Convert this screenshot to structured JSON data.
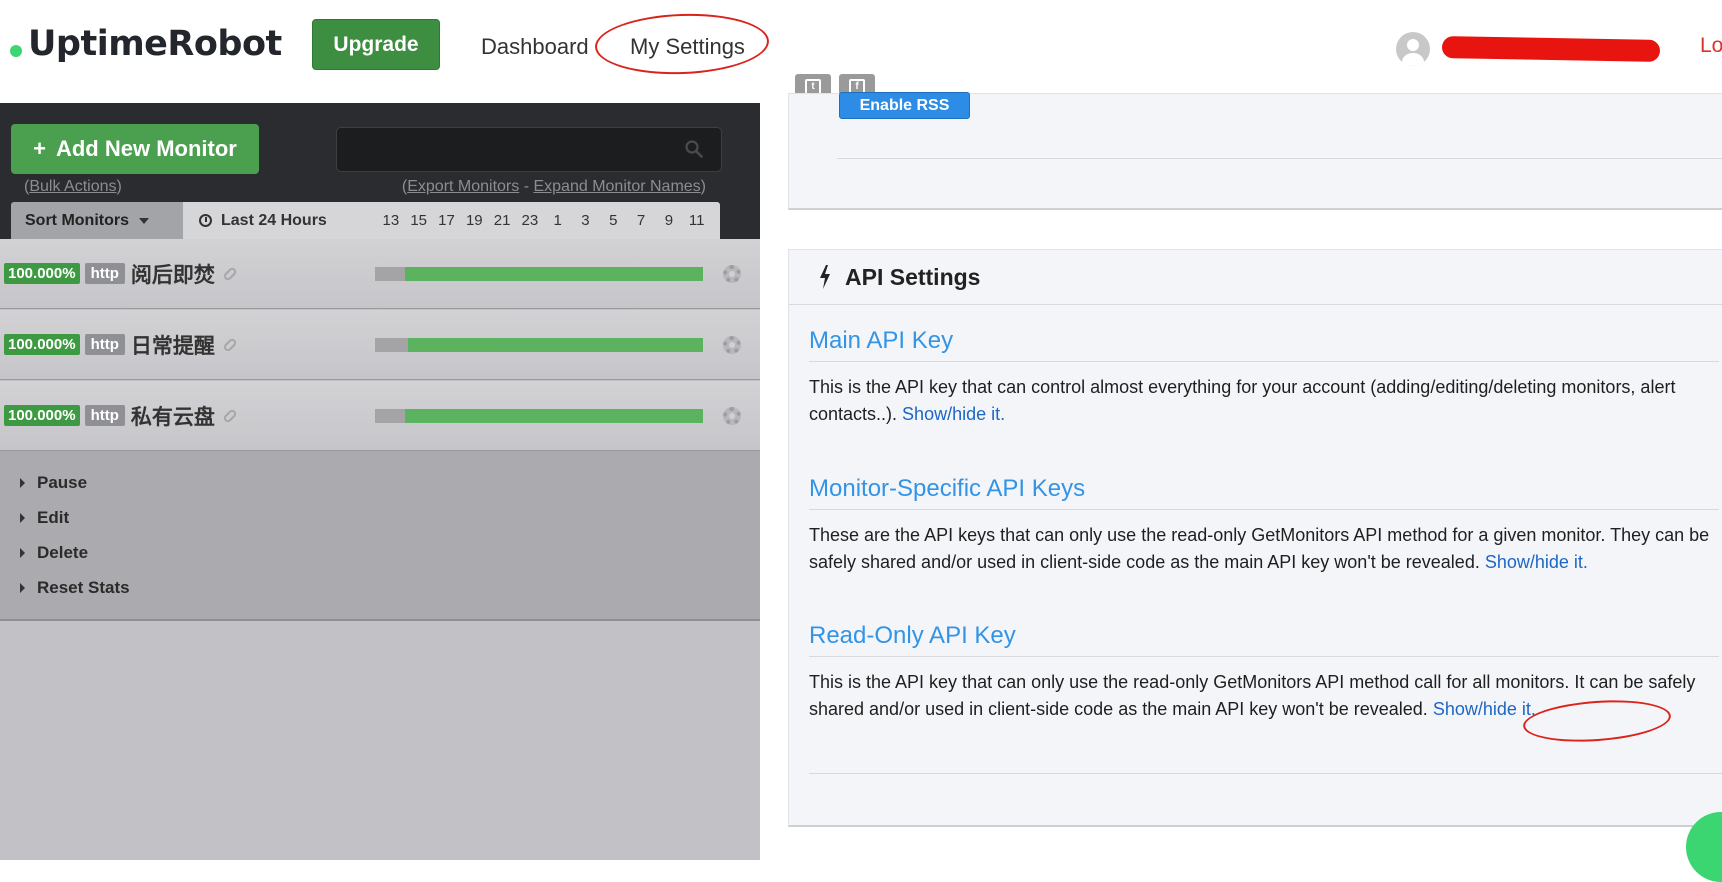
{
  "nav": {
    "logo": "UptimeRobot",
    "upgrade_label": "Upgrade",
    "dashboard_label": "Dashboard",
    "settings_label": "My Settings",
    "logout_label": "Lo"
  },
  "social": {
    "twitter_icon": "twitter-icon",
    "facebook_icon": "facebook-icon"
  },
  "left": {
    "add_monitor_label": "Add New Monitor",
    "search_placeholder": "",
    "bulk_open": "(",
    "bulk_actions": "Bulk Actions",
    "bulk_close": ")",
    "export_monitors": "Export Monitors",
    "expand_names": "Expand Monitor Names",
    "sort_label": "Sort Monitors",
    "range_label": "Last 24 Hours",
    "hours": [
      "13",
      "15",
      "17",
      "19",
      "21",
      "23",
      "1",
      "3",
      "5",
      "7",
      "9",
      "11"
    ],
    "monitors": [
      {
        "uptime": "100.000%",
        "type": "http",
        "name": "阅后即焚",
        "downtime_fraction": 0.09
      },
      {
        "uptime": "100.000%",
        "type": "http",
        "name": "日常提醒",
        "downtime_fraction": 0.1
      },
      {
        "uptime": "100.000%",
        "type": "http",
        "name": "私有云盘",
        "downtime_fraction": 0.09
      }
    ],
    "actions": [
      "Pause",
      "Edit",
      "Delete",
      "Reset Stats"
    ]
  },
  "right": {
    "rss_label": "Enable RSS",
    "api_title": "API Settings",
    "sections": [
      {
        "title": "Main API Key",
        "text": "This is the API key that can control almost everything for your account (adding/editing/deleting monitors, alert contacts..). ",
        "link": "Show/hide it."
      },
      {
        "title": "Monitor-Specific API Keys",
        "text": "These are the API keys that can only use the read-only GetMonitors API method for a given monitor. They can be safely shared and/or used in client-side code as the main API key won't be revealed. ",
        "link": "Show/hide it."
      },
      {
        "title": "Read-Only API Key",
        "text": "This is the API key that can only use the read-only GetMonitors API method call for all monitors. It can be safely shared and/or used in client-side code as the main API key won't be revealed. ",
        "link": "Show/hide it."
      }
    ]
  },
  "colors": {
    "brand_green": "#3bd671",
    "upgrade_green": "#3e8e41",
    "link_blue": "#1d67c4",
    "heading_blue": "#3394e6",
    "annotation_red": "#d9241c"
  }
}
